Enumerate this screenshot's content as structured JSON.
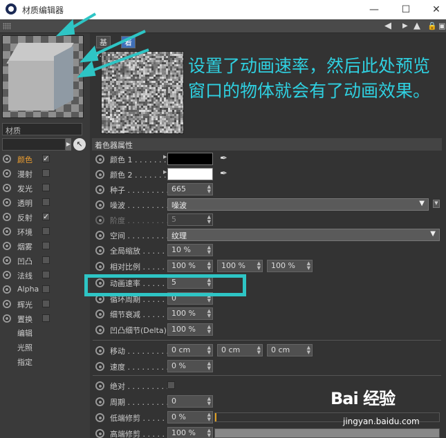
{
  "window": {
    "title": "材质编辑器",
    "minimize": "—",
    "maximize": "☐",
    "close": "✕"
  },
  "toolbar": {
    "icons": [
      "arrow-left-icon",
      "arrow-up-icon",
      "lock-icon",
      "window-icon"
    ]
  },
  "material": {
    "name": "材质"
  },
  "channels": [
    {
      "label": "颜色",
      "checked": true,
      "active": true
    },
    {
      "label": "漫射",
      "checked": false
    },
    {
      "label": "发光",
      "checked": false
    },
    {
      "label": "透明",
      "checked": false
    },
    {
      "label": "反射",
      "checked": true
    },
    {
      "label": "环境",
      "checked": false
    },
    {
      "label": "烟雾",
      "checked": false
    },
    {
      "label": "凹凸",
      "checked": false
    },
    {
      "label": "法线",
      "checked": false
    },
    {
      "label": "Alpha",
      "checked": false
    },
    {
      "label": "辉光",
      "checked": false
    },
    {
      "label": "置换",
      "checked": false
    }
  ],
  "extra_items": [
    "编辑",
    "光照",
    "指定"
  ],
  "tabs": [
    {
      "label": "基本"
    },
    {
      "label": "着色器"
    }
  ],
  "annotation": "设置了动画速率，然后此处预览窗口的物体就会有了动画效果。",
  "section_title": "着色器属性",
  "props": {
    "color1": {
      "label": "颜色 1 . . . . . . .",
      "swatch": "#000000"
    },
    "color2": {
      "label": "颜色 2 . . . . . . .",
      "swatch": "#ffffff"
    },
    "seed": {
      "label": "种子 . . . . . . . . .",
      "value": "665"
    },
    "noise": {
      "label": "噪波 . . . . . . . . .",
      "value": "噪波"
    },
    "octaves": {
      "label": "阶度 . . . . . . . . .",
      "value": "5"
    },
    "space": {
      "label": "空间 . . . . . . . . .",
      "value": "纹理"
    },
    "global_scale": {
      "label": "全局缩放 . . . . .",
      "value": "10 %"
    },
    "relative_scale": {
      "label": "相对比例 . . . . .",
      "values": [
        "100 %",
        "100 %",
        "100 %"
      ]
    },
    "anim_speed": {
      "label": "动画速率 . . . . .",
      "value": "5"
    },
    "loop_period": {
      "label": "循环周期 . . . . .",
      "value": "0"
    },
    "detail_atten": {
      "label": "细节衰减 . . . . .",
      "value": "100 %"
    },
    "delta": {
      "label": "凹凸细节(Delta)",
      "value": "100 %"
    },
    "move": {
      "label": "移动 . . . . . . . . .",
      "values": [
        "0 cm",
        "0 cm",
        "0 cm"
      ]
    },
    "speed": {
      "label": "速度 . . . . . . . . .",
      "value": "0 %"
    },
    "absolute": {
      "label": "绝对 . . . . . . . . ."
    },
    "period": {
      "label": "周期 . . . . . . . . .",
      "value": "0"
    },
    "low_clip": {
      "label": "低端修剪 . . . . .",
      "value": "0 %",
      "fill": 0.0
    },
    "high_clip": {
      "label": "高端修剪 . . . . .",
      "value": "100 %",
      "fill": 1.0
    }
  },
  "watermark": {
    "logo": "Bai 经验",
    "url": "jingyan.baidu.com"
  },
  "colors": {
    "accent_cyan": "#2ec5c5",
    "tab_active": "#3f6fb8",
    "active_channel": "#f0a030",
    "bar_fill": "#e0a020"
  }
}
